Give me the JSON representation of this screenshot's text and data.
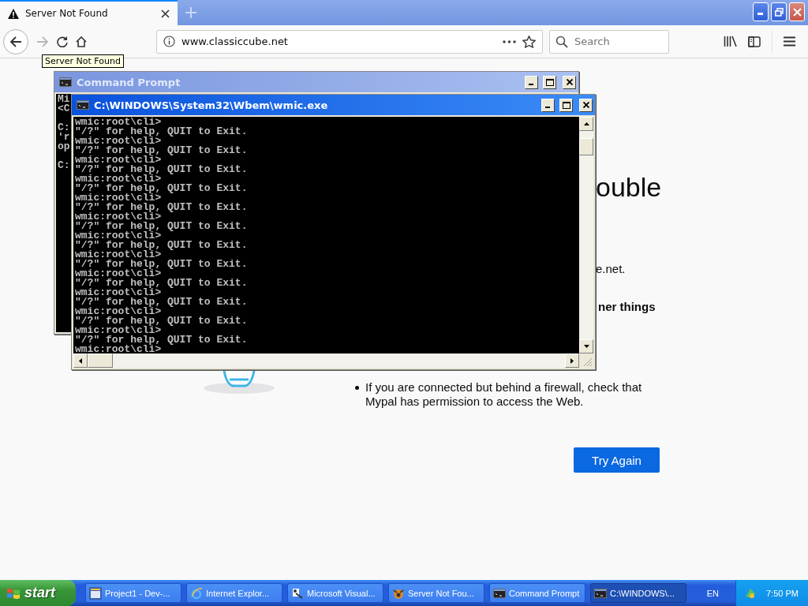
{
  "browser": {
    "tab": {
      "title": "Server Not Found",
      "selected": true
    },
    "tooltip": "Server Not Found",
    "url": "www.classiccube.net",
    "search": {
      "placeholder": "Search"
    },
    "page": {
      "heading": "ouble",
      "line_1": "e.net.",
      "line_2": "ner things",
      "bullet": "If you are connected but behind a firewall, check that Mypal has permission to access the Web.",
      "button": "Try Again"
    }
  },
  "windows": [
    {
      "title": "Command Prompt",
      "active": false,
      "blocks": [
        [
          "Mi",
          "<C"
        ],
        [
          "C:",
          "'r",
          "op"
        ],
        [
          "C:"
        ]
      ]
    },
    {
      "title": "C:\\WINDOWS\\System32\\Wbem\\wmic.exe",
      "active": true,
      "blocks": [
        [
          "wmic:root\\cli>",
          "\"/?\" for help, QUIT to Exit.",
          "wmic:root\\cli>",
          "\"/?\" for help, QUIT to Exit.",
          "wmic:root\\cli>",
          "\"/?\" for help, QUIT to Exit.",
          "wmic:root\\cli>",
          "\"/?\" for help, QUIT to Exit.",
          "wmic:root\\cli>",
          "\"/?\" for help, QUIT to Exit.",
          "wmic:root\\cli>",
          "\"/?\" for help, QUIT to Exit.",
          "wmic:root\\cli>",
          "\"/?\" for help, QUIT to Exit.",
          "wmic:root\\cli>",
          "\"/?\" for help, QUIT to Exit.",
          "wmic:root\\cli>",
          "\"/?\" for help, QUIT to Exit.",
          "wmic:root\\cli>",
          "\"/?\" for help, QUIT to Exit.",
          "wmic:root\\cli>",
          "\"/?\" for help, QUIT to Exit.",
          "wmic:root\\cli>",
          "\"/?\" for help, QUIT to Exit.",
          "wmic:root\\cli>"
        ]
      ]
    }
  ],
  "taskbar": {
    "start": "start",
    "items": [
      {
        "label": "Project1 - Dev-...",
        "kind": "ide",
        "selected": false
      },
      {
        "label": "Internet Explor...",
        "kind": "ie",
        "selected": false
      },
      {
        "label": "Microsoft Visual...",
        "kind": "vs",
        "selected": false
      },
      {
        "label": "Server Not Fou...",
        "kind": "browser",
        "selected": false
      },
      {
        "label": "Command Prompt",
        "kind": "console",
        "selected": false
      },
      {
        "label": "C:\\WINDOWS\\...",
        "kind": "console",
        "selected": true
      }
    ],
    "language": "EN",
    "clock": "7:50 PM"
  }
}
